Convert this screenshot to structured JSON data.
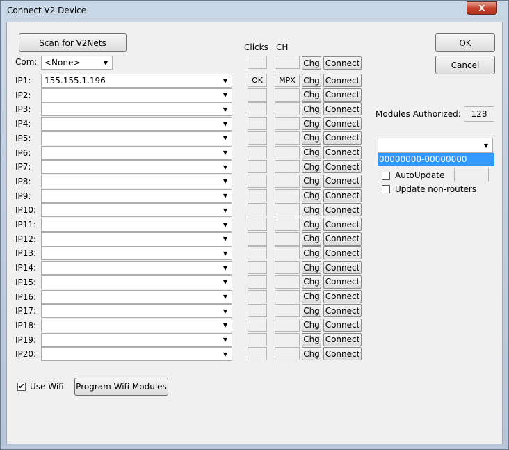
{
  "window": {
    "title": "Connect V2 Device",
    "close_label": "X"
  },
  "scan_button": "Scan for V2Nets",
  "com": {
    "label": "Com:",
    "value": "<None>"
  },
  "headers": {
    "clicks": "Clicks",
    "ch": "CH"
  },
  "ok_button": "OK",
  "cancel_button": "Cancel",
  "rows": [
    {
      "label": "IP1:",
      "value": "155.155.1.196",
      "clicks": "OK",
      "ch": "MPX"
    },
    {
      "label": "IP2:",
      "value": "",
      "clicks": "",
      "ch": ""
    },
    {
      "label": "IP3:",
      "value": "",
      "clicks": "",
      "ch": ""
    },
    {
      "label": "IP4:",
      "value": "",
      "clicks": "",
      "ch": ""
    },
    {
      "label": "IP5:",
      "value": "",
      "clicks": "",
      "ch": ""
    },
    {
      "label": "IP6:",
      "value": "",
      "clicks": "",
      "ch": ""
    },
    {
      "label": "IP7:",
      "value": "",
      "clicks": "",
      "ch": ""
    },
    {
      "label": "IP8:",
      "value": "",
      "clicks": "",
      "ch": ""
    },
    {
      "label": "IP9:",
      "value": "",
      "clicks": "",
      "ch": ""
    },
    {
      "label": "IP10:",
      "value": "",
      "clicks": "",
      "ch": ""
    },
    {
      "label": "IP11:",
      "value": "",
      "clicks": "",
      "ch": ""
    },
    {
      "label": "IP12:",
      "value": "",
      "clicks": "",
      "ch": ""
    },
    {
      "label": "IP13:",
      "value": "",
      "clicks": "",
      "ch": ""
    },
    {
      "label": "IP14:",
      "value": "",
      "clicks": "",
      "ch": ""
    },
    {
      "label": "IP15:",
      "value": "",
      "clicks": "",
      "ch": ""
    },
    {
      "label": "IP16:",
      "value": "",
      "clicks": "",
      "ch": ""
    },
    {
      "label": "IP17:",
      "value": "",
      "clicks": "",
      "ch": ""
    },
    {
      "label": "IP18:",
      "value": "",
      "clicks": "",
      "ch": ""
    },
    {
      "label": "IP19:",
      "value": "",
      "clicks": "",
      "ch": ""
    },
    {
      "label": "IP20:",
      "value": "",
      "clicks": "",
      "ch": ""
    }
  ],
  "chg_label": "Chg",
  "connect_label": "Connect",
  "modules": {
    "label": "Modules Authorized:",
    "value": "128"
  },
  "module_select": {
    "value": "",
    "list_item": "00000000-00000000"
  },
  "autoupdate": {
    "label": "AutoUpdate",
    "checked": false,
    "value": ""
  },
  "update_nonrouters": {
    "label": "Update non-routers",
    "checked": false
  },
  "use_wifi": {
    "label": "Use Wifi",
    "checked": true,
    "check_mark": "✔"
  },
  "program_wifi_button": "Program Wifi Modules",
  "colors": {
    "selection": "#3399ff",
    "title_close": "#c7452f"
  }
}
